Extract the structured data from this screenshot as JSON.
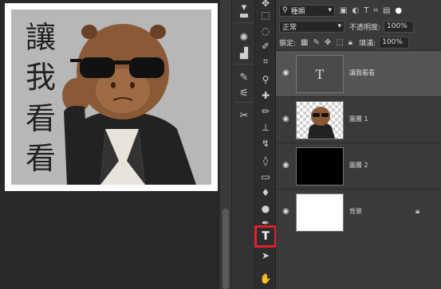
{
  "canvas": {
    "artwork_text": "讓我看看",
    "colors": {
      "artwork_bg": "#b7b7b7",
      "doc_bg": "#ffffff"
    }
  },
  "mini_panels": [
    "brush-settings-icon",
    "comment-icon",
    "navigator-icon",
    "histogram-icon",
    "brushes-icon",
    "adjust-icon",
    "tools-icon"
  ],
  "toolbar": {
    "tools": [
      "move-icon",
      "marquee-icon",
      "lasso-icon",
      "quick-select-icon",
      "crop-icon",
      "eyedropper-icon",
      "healing-icon",
      "brush-icon",
      "stamp-icon",
      "history-brush-icon",
      "eraser-icon",
      "gradient-icon",
      "blur-icon",
      "dodge-icon",
      "pen-icon",
      "type-icon",
      "path-select-icon",
      "hand-icon"
    ],
    "active_tool": "type-icon",
    "type_glyph": "T",
    "highlight_color": "#e1202d"
  },
  "layers_panel": {
    "filter_label": "種類",
    "blend_mode": "正常",
    "opacity_label": "不透明度:",
    "opacity_value": "100%",
    "lock_label": "鎖定:",
    "fill_label": "填滿:",
    "fill_value": "100%",
    "layers": [
      {
        "name": "讓我看看",
        "kind": "text",
        "thumb_glyph": "T",
        "selected": true
      },
      {
        "name": "圖層 1",
        "kind": "image",
        "selected": false
      },
      {
        "name": "圖層 2",
        "kind": "fill-black",
        "selected": false
      },
      {
        "name": "背景",
        "kind": "fill-white",
        "locked": true,
        "selected": false
      }
    ]
  }
}
